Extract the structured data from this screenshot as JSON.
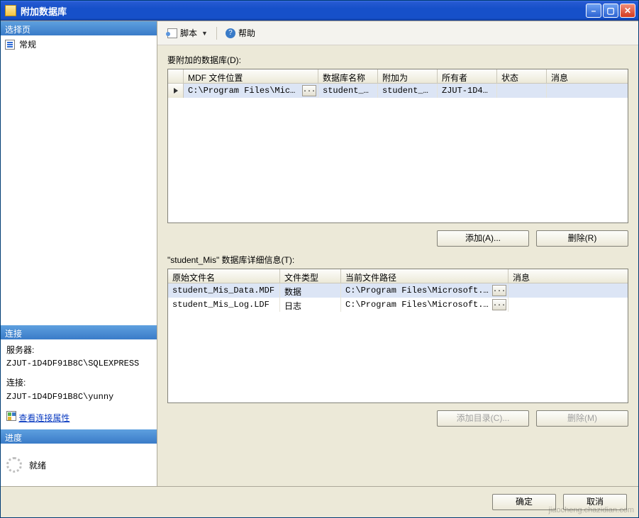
{
  "window": {
    "title": "附加数据库"
  },
  "sidebar": {
    "select_header": "选择页",
    "general_item": "常规",
    "conn_header": "连接",
    "server_label": "服务器:",
    "server_value": "ZJUT-1D4DF91B8C\\SQLEXPRESS",
    "conn_label": "连接:",
    "conn_value": "ZJUT-1D4DF91B8C\\yunny",
    "view_props": "查看连接属性",
    "progress_header": "进度",
    "progress_status": "就绪"
  },
  "toolbar": {
    "script": "脚本",
    "help": "帮助"
  },
  "main": {
    "attach_label": "要附加的数据库(D):",
    "top_headers": {
      "mdf": "MDF 文件位置",
      "dbname": "数据库名称",
      "attachas": "附加为",
      "owner": "所有者",
      "status": "状态",
      "msg": "消息"
    },
    "top_row": {
      "mdf": "C:\\Program Files\\Micr...",
      "dbname": "student_Mis",
      "attachas": "student_Mis",
      "owner": "ZJUT-1D4...",
      "status": "",
      "msg": ""
    },
    "add_btn": "添加(A)...",
    "remove_btn": "删除(R)",
    "detail_label": "\"student_Mis\" 数据库详细信息(T):",
    "bot_headers": {
      "origname": "原始文件名",
      "ftype": "文件类型",
      "curpath": "当前文件路径",
      "msg": "消息"
    },
    "bot_rows": [
      {
        "orig": "student_Mis_Data.MDF",
        "type": "数据",
        "path": "C:\\Program Files\\Microsoft...",
        "msg": ""
      },
      {
        "orig": "student_Mis_Log.LDF",
        "type": "日志",
        "path": "C:\\Program Files\\Microsoft...",
        "msg": ""
      }
    ],
    "adddir_btn": "添加目录(C)...",
    "remove2_btn": "删除(M)"
  },
  "footer": {
    "ok": "确定",
    "cancel": "取消"
  },
  "watermark": "jiaocheng.chazidian.com"
}
